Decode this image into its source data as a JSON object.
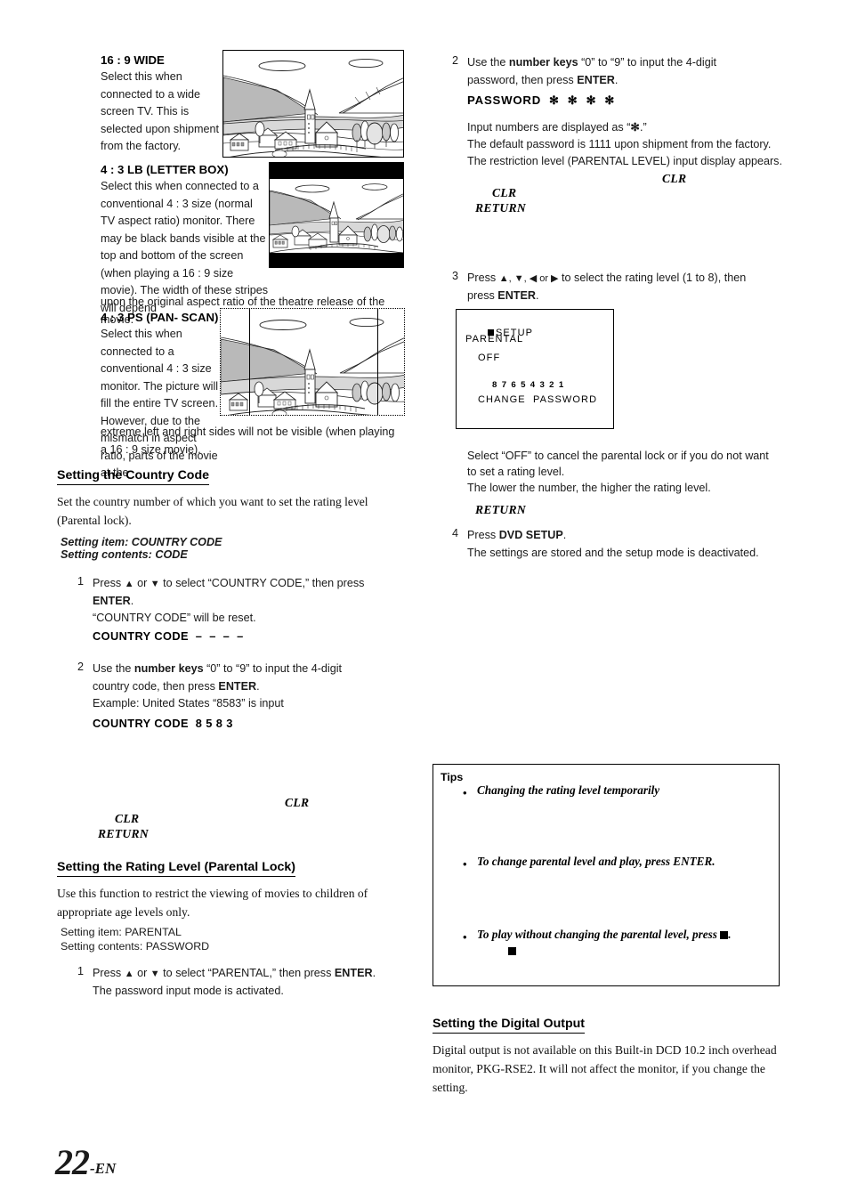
{
  "page": {
    "number": "22",
    "suffix": "-EN"
  },
  "left_column": {
    "modes": [
      {
        "title": "16 : 9 WIDE",
        "text": "Select this when connected to a wide screen TV. This is selected upon shipment from the factory.",
        "image_caption": "village-landscape-wide"
      },
      {
        "title": "4 : 3 LB (LETTER BOX)",
        "text": "Select this when connected to a conventional 4 : 3 size (normal TV aspect ratio) monitor. There may be black bands visible at the top and bottom of  the screen (when playing a 16 : 9 size movie). The width of these stripes will depend",
        "text_overflow": "upon the original aspect ratio of the theatre release of the movie.",
        "image_caption": "village-landscape-letterbox"
      },
      {
        "title": "4 : 3 PS (PAN- SCAN)",
        "text": "Select this when connected to a conventional 4 : 3 size monitor. The picture will fill the entire TV screen. However, due to the mismatch in aspect ratio, parts of the movie at the",
        "text_overflow": "extreme left and right sides will not be visible (when playing a 16 : 9 size movie).",
        "image_caption": "village-landscape-panscan"
      }
    ],
    "country_code_section": {
      "heading": "Setting the Country Code",
      "intro": "Set the country number of which you want to set the rating level (Parental lock).",
      "setting_item": "Setting item: COUNTRY CODE",
      "setting_contents": "Setting contents: CODE",
      "steps": [
        {
          "num": "1",
          "line1_pre": "Press ",
          "line1_arrow_up": "▲",
          "line1_mid": " or ",
          "line1_arrow_down": "▼",
          "line1_post": " to select “COUNTRY CODE,” then press",
          "line2_bold": "ENTER",
          "line2_post": ".",
          "line3": "“COUNTRY CODE” will be reset.",
          "display": "COUNTRY CODE  –  –  –  –"
        },
        {
          "num": "2",
          "line1_pre": "Use the ",
          "line1_bold": "number keys",
          "line1_post": " “0” to “9” to input the 4-digit",
          "line2_pre": "country code, then press ",
          "line2_bold": "ENTER",
          "line2_post": ".",
          "line3": "Example: United States “8583” is input",
          "display": "COUNTRY CODE  8 5 8 3"
        }
      ],
      "key_labels": [
        {
          "text": "CLR"
        },
        {
          "text": "CLR"
        },
        {
          "text": "RETURN"
        }
      ]
    },
    "rating_section": {
      "heading": "Setting the Rating Level (Parental Lock)",
      "intro": "Use this function to restrict the viewing of movies to children of appropriate age levels only.",
      "setting_item": "Setting item: PARENTAL",
      "setting_contents": "Setting contents: PASSWORD",
      "step": {
        "num": "1",
        "line1_pre": "Press ",
        "line1_arrow_up": "▲",
        "line1_mid": " or ",
        "line1_arrow_down": "▼",
        "line1_post": " to select “PARENTAL,” then press ",
        "line1_bold": "ENTER",
        "line1_end": ".",
        "line2": "The password input mode is activated."
      }
    }
  },
  "right_column": {
    "step2": {
      "num": "2",
      "line1_pre": "Use the ",
      "line1_bold": "number keys",
      "line1_post": " “0” to “9” to input the 4-digit",
      "line2_pre": "password, then press ",
      "line2_bold": "ENTER",
      "line2_post": ".",
      "display": "PASSWORD  ✻  ✻  ✻  ✻",
      "note1_pre": "Input numbers are displayed as “",
      "note1_star": "✻",
      "note1_post": ".”",
      "note2": "The default password is 1111 upon shipment from the factory.",
      "note3": "The restriction level (PARENTAL LEVEL) input display appears.",
      "key_labels": [
        {
          "text": "CLR"
        },
        {
          "text": "CLR"
        },
        {
          "text": "RETURN"
        }
      ]
    },
    "step3": {
      "num": "3",
      "line1_pre": "Press ",
      "line1_arrows": "▲, ▼, ◀ or ▶",
      "line1_post": " to select the rating level (1 to 8), then",
      "line2_pre": "press ",
      "line2_bold": "ENTER",
      "line2_post": "."
    },
    "osd": {
      "title": "SETUP",
      "menu_item": "PARENTAL",
      "off_label": "OFF",
      "levels": [
        "8",
        "7",
        "6",
        "5",
        "4",
        "3",
        "2",
        "1"
      ],
      "change_password": "CHANGE  PASSWORD"
    },
    "after_osd": {
      "line1": "Select “OFF” to cancel the parental lock or if you do not want",
      "line2": "to set a rating level.",
      "line3": "The lower the number, the higher the rating level.",
      "key_label": "RETURN"
    },
    "step4": {
      "num": "4",
      "line1_pre": "Press ",
      "line1_bold": "DVD SETUP",
      "line1_post": ".",
      "line2": "The settings are stored and the setup mode is deactivated."
    },
    "tips": {
      "label": "Tips",
      "items": [
        {
          "bullet": "•",
          "text": "Changing the rating level temporarily"
        },
        {
          "bullet": "•",
          "text": "To change parental level and play, press ENTER."
        },
        {
          "bullet": "•",
          "text_pre": "To play without changing the parental level, press ",
          "text_post": "."
        }
      ]
    },
    "digital_output": {
      "heading": "Setting the Digital Output",
      "text": "Digital output is not available on this Built-in DCD 10.2 inch overhead monitor, PKG-RSE2. It will not affect the monitor, if you change the setting."
    }
  },
  "colors": {
    "text": "#1a1a1a",
    "rule": "#000000",
    "mountain_fill": "#b8b8b8",
    "band": "#000000"
  }
}
